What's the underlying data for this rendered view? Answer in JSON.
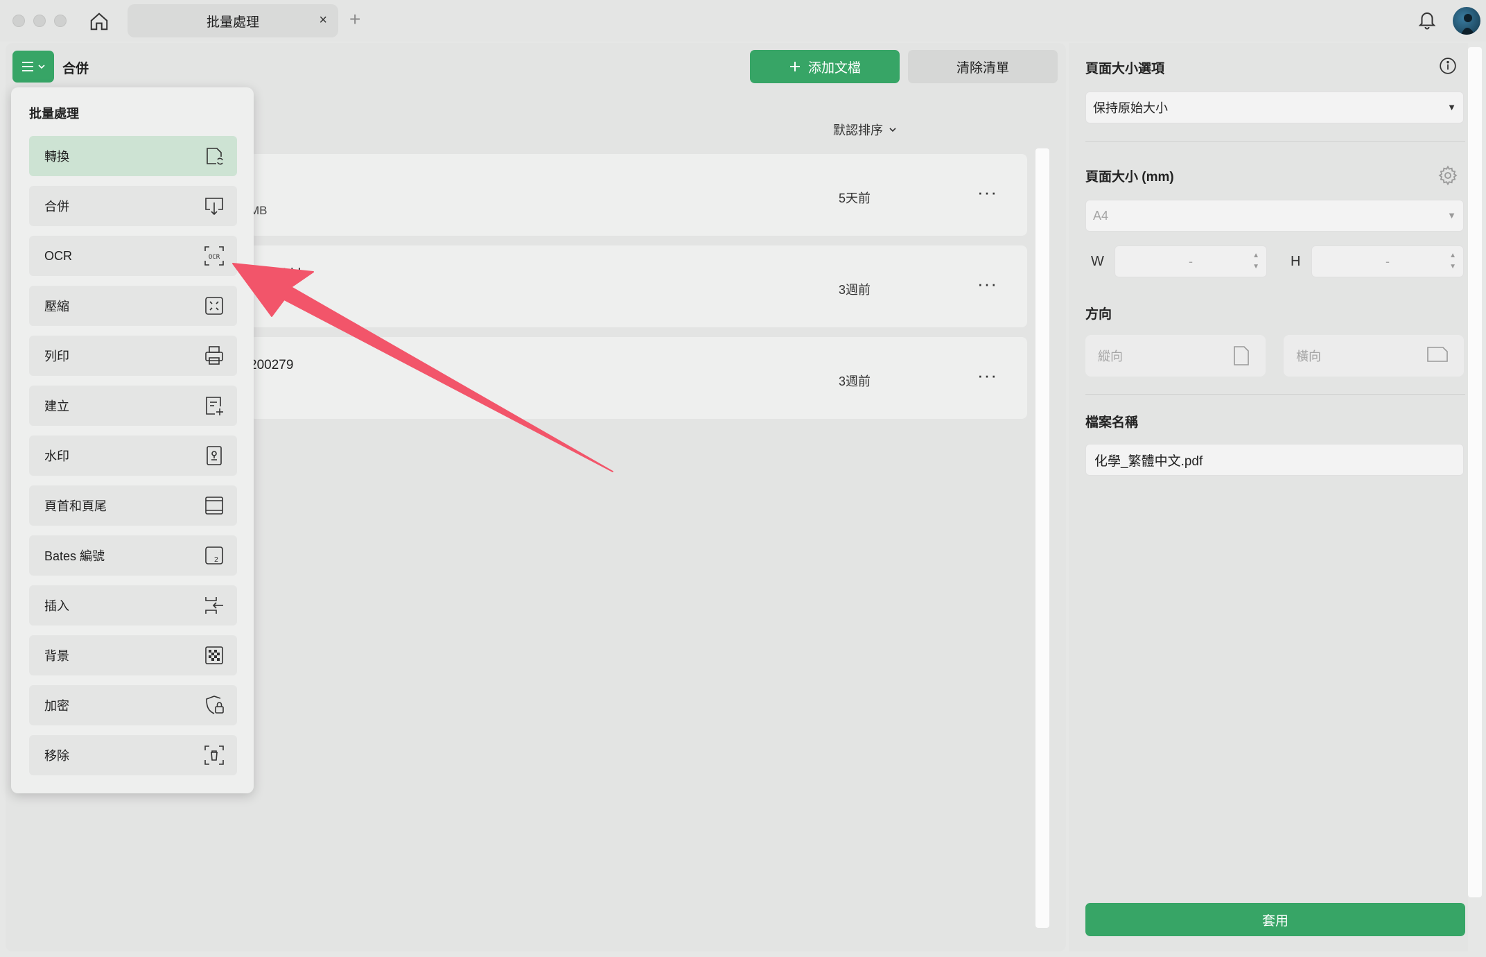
{
  "window": {
    "tab_title": "批量處理",
    "tab_close": "×",
    "tab_add": "+"
  },
  "toolbar": {
    "mode_title": "合併",
    "add_files_label": "添加文檔",
    "clear_list_label": "清除清單",
    "sort_label": "默認排序"
  },
  "files": [
    {
      "name": "",
      "size": "MB",
      "time": "5天前",
      "more": "···"
    },
    {
      "name": "51_a5dd",
      "size": "",
      "time": "3週前",
      "more": "···"
    },
    {
      "name": "200279",
      "size": "",
      "time": "3週前",
      "more": "···"
    }
  ],
  "menu": {
    "title": "批量處理",
    "items": [
      {
        "label": "轉換",
        "icon": "convert-icon",
        "active": true
      },
      {
        "label": "合併",
        "icon": "merge-icon",
        "active": false
      },
      {
        "label": "OCR",
        "icon": "ocr-icon",
        "active": false
      },
      {
        "label": "壓縮",
        "icon": "compress-icon",
        "active": false
      },
      {
        "label": "列印",
        "icon": "printer-icon",
        "active": false
      },
      {
        "label": "建立",
        "icon": "create-icon",
        "active": false
      },
      {
        "label": "水印",
        "icon": "watermark-icon",
        "active": false
      },
      {
        "label": "頁首和頁尾",
        "icon": "header-footer-icon",
        "active": false
      },
      {
        "label": "Bates 編號",
        "icon": "bates-icon",
        "active": false
      },
      {
        "label": "插入",
        "icon": "insert-icon",
        "active": false
      },
      {
        "label": "背景",
        "icon": "background-icon",
        "active": false
      },
      {
        "label": "加密",
        "icon": "encrypt-icon",
        "active": false
      },
      {
        "label": "移除",
        "icon": "remove-icon",
        "active": false
      }
    ]
  },
  "panel": {
    "page_size_options_label": "頁面大小選項",
    "page_size_option_value": "保持原始大小",
    "page_size_mm_label": "頁面大小 (mm)",
    "page_size_value": "A4",
    "width_label": "W",
    "width_value": "-",
    "height_label": "H",
    "height_value": "-",
    "orientation_label": "方向",
    "portrait_label": "縱向",
    "landscape_label": "橫向",
    "file_name_label": "檔案名稱",
    "file_name_value": "化學_繁體中文.pdf",
    "apply_label": "套用"
  },
  "colors": {
    "accent": "#37a566",
    "annotation_arrow": "#f2556a"
  }
}
